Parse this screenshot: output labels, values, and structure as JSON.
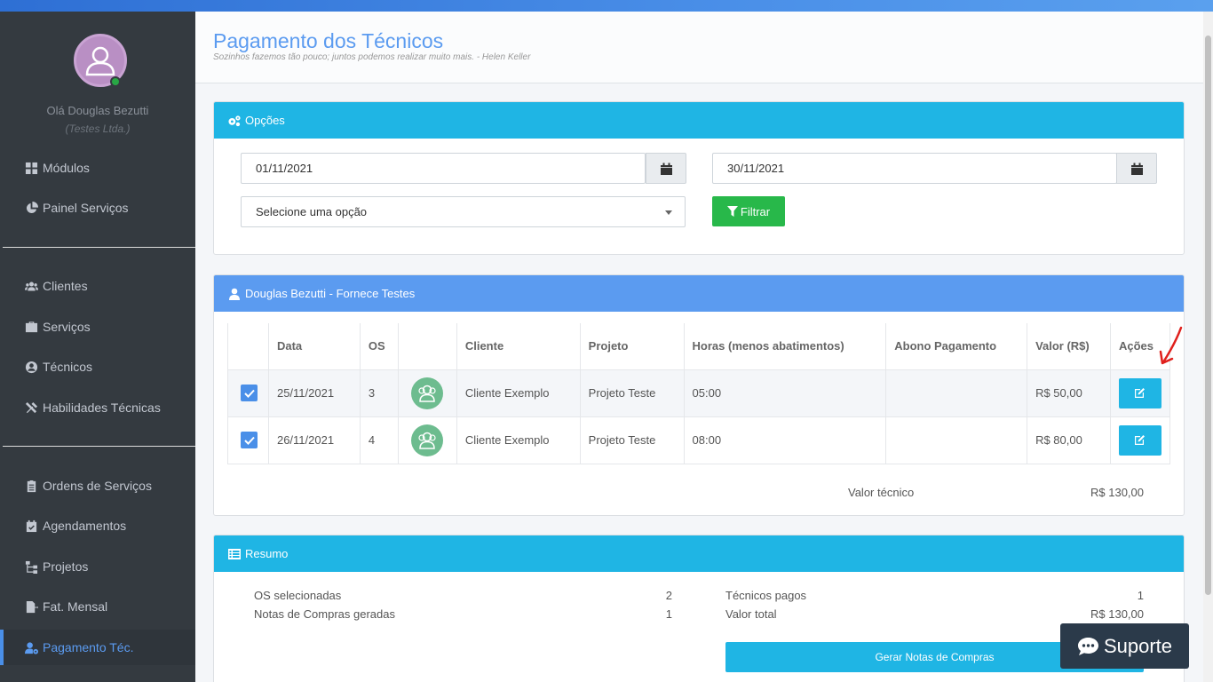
{
  "sidebar": {
    "user": {
      "greeting": "Olá Douglas Bezutti",
      "company": "(Testes Ltda.)"
    },
    "items": [
      {
        "label": "Módulos",
        "icon": "grid-icon"
      },
      {
        "label": "Painel Serviços",
        "icon": "pie-chart-icon"
      },
      {
        "label": "Clientes",
        "icon": "users-icon"
      },
      {
        "label": "Serviços",
        "icon": "briefcase-icon"
      },
      {
        "label": "Técnicos",
        "icon": "user-circle-icon"
      },
      {
        "label": "Habilidades Técnicas",
        "icon": "tools-icon"
      },
      {
        "label": "Ordens de Serviços",
        "icon": "clipboard-icon"
      },
      {
        "label": "Agendamentos",
        "icon": "calendar-check-icon"
      },
      {
        "label": "Projetos",
        "icon": "sitemap-icon"
      },
      {
        "label": "Fat. Mensal",
        "icon": "file-export-icon"
      },
      {
        "label": "Pagamento Téc.",
        "icon": "user-cog-icon",
        "active": true
      }
    ]
  },
  "header": {
    "title": "Pagamento dos Técnicos",
    "quote": "Sozinhos fazemos tão pouco; juntos podemos realizar muito mais. - Helen Keller"
  },
  "options": {
    "title": "Opções",
    "date_start": "01/11/2021",
    "date_end": "30/11/2021",
    "select_value": "Selecione uma opção",
    "filter_label": "Filtrar"
  },
  "technician": {
    "title": "Douglas Bezutti - Fornece Testes",
    "columns": [
      "",
      "Data",
      "OS",
      "",
      "Cliente",
      "Projeto",
      "Horas (menos abatimentos)",
      "Abono Pagamento",
      "Valor (R$)",
      "Ações"
    ],
    "rows": [
      {
        "checked": true,
        "date": "25/11/2021",
        "os": "3",
        "client": "Cliente Exemplo",
        "project": "Projeto Teste",
        "hours": "05:00",
        "abono": "",
        "value": "R$ 50,00"
      },
      {
        "checked": true,
        "date": "26/11/2021",
        "os": "4",
        "client": "Cliente Exemplo",
        "project": "Projeto Teste",
        "hours": "08:00",
        "abono": "",
        "value": "R$ 80,00"
      }
    ],
    "total_label": "Valor técnico",
    "total_value": "R$ 130,00"
  },
  "summary": {
    "title": "Resumo",
    "os_selected_label": "OS selecionadas",
    "os_selected_value": "2",
    "notes_label": "Notas de Compras geradas",
    "notes_value": "1",
    "techs_paid_label": "Técnicos pagos",
    "techs_paid_value": "1",
    "total_label": "Valor total",
    "total_value": "R$ 130,00",
    "generate_label": "Gerar Notas de Compras"
  },
  "support": {
    "label": "Suporte"
  },
  "colors": {
    "primary": "#5b9bf0",
    "cyan": "#1fb5e4",
    "green": "#28b84a",
    "sidebar": "#343a40"
  }
}
